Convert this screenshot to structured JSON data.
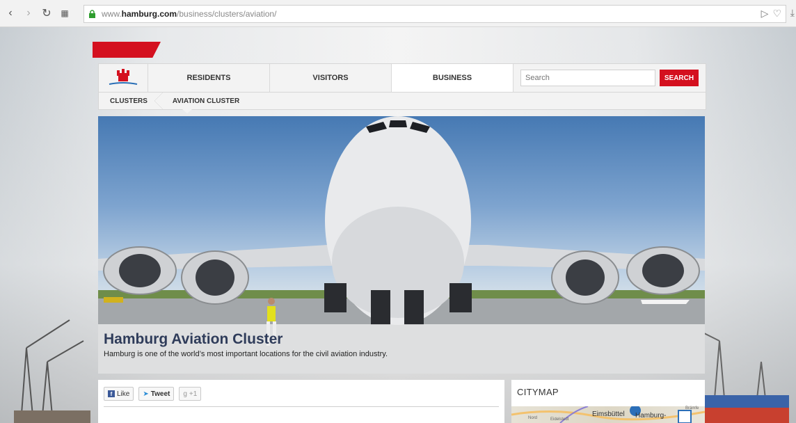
{
  "browser": {
    "back_icon": "chevron-left-icon",
    "forward_icon": "chevron-right-icon",
    "reload_icon": "reload-icon",
    "apps_icon": "grid-icon",
    "url_prefix": "www.",
    "url_domain": "hamburg.com",
    "url_path": "/business/clusters/aviation/",
    "lock_color": "#2e9d2e"
  },
  "header": {
    "nav": [
      "RESIDENTS",
      "VISITORS",
      "BUSINESS"
    ],
    "active_nav": "BUSINESS",
    "search_placeholder": "Search",
    "search_button": "SEARCH",
    "accent_color": "#d4101f"
  },
  "breadcrumb": {
    "items": [
      "CLUSTERS",
      "AVIATION CLUSTER"
    ]
  },
  "hero": {
    "title": "Hamburg Aviation Cluster",
    "subtitle": "Hamburg is one of the world’s most important locations for the civil aviation industry."
  },
  "share": {
    "like": "Like",
    "tweet": "Tweet",
    "plusone": "+1"
  },
  "citymap": {
    "title": "CITYMAP",
    "labels": [
      "Eimsbüttel",
      "Hamburg-",
      "Eidelstedt",
      "Nord",
      "Brämfe"
    ]
  }
}
